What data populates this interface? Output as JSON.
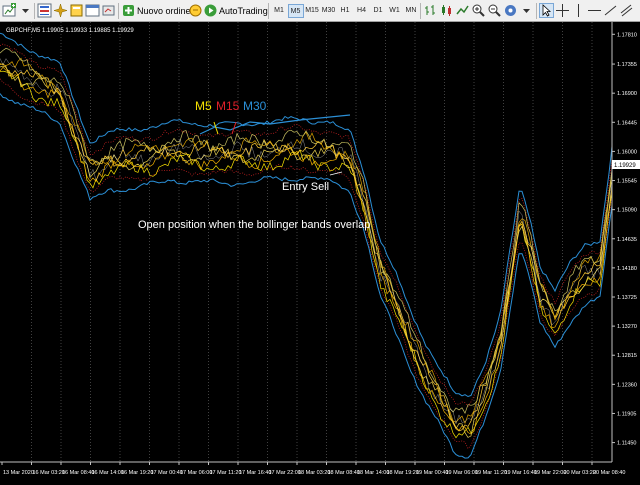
{
  "toolbar": {
    "new_order_label": "Nuovo ordine",
    "autotrading_label": "AutoTrading",
    "timeframes": [
      "M1",
      "M5",
      "M15",
      "M30",
      "H1",
      "H4",
      "D1",
      "W1",
      "MN"
    ],
    "active_timeframe": "M5"
  },
  "chart": {
    "header": "GBPCHF,M5  1.19905 1.19933 1.19885 1.19929",
    "legend": [
      {
        "label": "M5",
        "color": "#f5e000"
      },
      {
        "label": "M15",
        "color": "#e0202a"
      },
      {
        "label": "M30",
        "color": "#2b8fd6"
      }
    ],
    "entry_label": "Entry Sell",
    "note": "Open position when the bollinger bands overlap",
    "current_price": "1.19929"
  },
  "chart_data": {
    "type": "line",
    "symbol": "GBPCHF",
    "timeframe": "M5",
    "yticks": [
      1.1781,
      1.1735,
      1.169,
      1.1645,
      1.16,
      1.1555,
      1.151,
      1.1465,
      1.142,
      1.1375,
      1.133,
      1.1285,
      1.124,
      1.1195,
      1.115
    ],
    "ytick_labels": [
      "1.17810",
      "1.17355",
      "1.16900",
      "1.16445",
      "1.16000",
      "1.15545",
      "1.15090",
      "1.14635",
      "1.14180",
      "1.13725",
      "1.13270",
      "1.12815",
      "1.12360",
      "1.11905",
      "1.11450"
    ],
    "xlabels": [
      "13 Mar 2020",
      "16 Mar 03:20",
      "16 Mar 08:40",
      "16 Mar 14:00",
      "16 Mar 19:20",
      "17 Mar 00:40",
      "17 Mar 06:00",
      "17 Mar 11:20",
      "17 Mar 16:40",
      "17 Mar 22:00",
      "18 Mar 03:20",
      "18 Mar 08:40",
      "18 Mar 14:00",
      "18 Mar 19:20",
      "19 Mar 00:40",
      "19 Mar 06:00",
      "19 Mar 11:20",
      "19 Mar 16:40",
      "19 Mar 22:00",
      "20 Mar 03:20",
      "20 Mar 08:40"
    ],
    "ylim": [
      1.112,
      1.18
    ],
    "series": [
      {
        "name": "M5",
        "color": "#f5e000"
      },
      {
        "name": "M15",
        "color": "#e0202a"
      },
      {
        "name": "M30",
        "color": "#2b8fd6"
      }
    ]
  }
}
